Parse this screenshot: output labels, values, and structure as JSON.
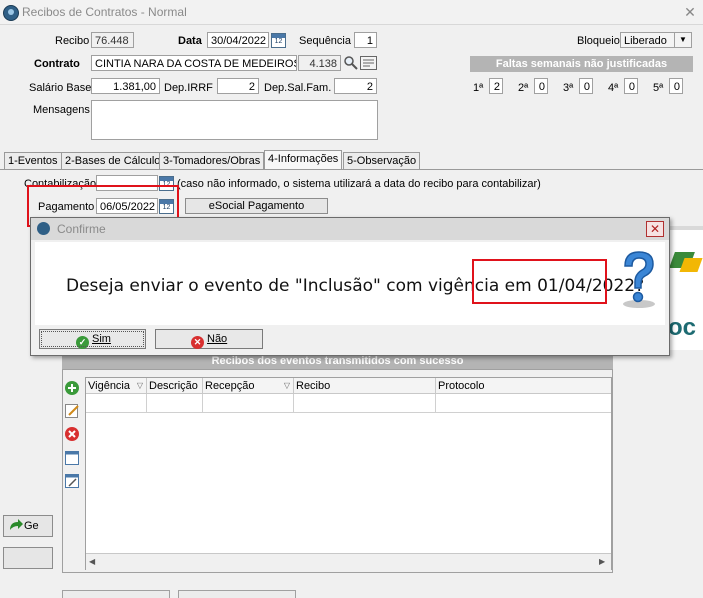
{
  "window": {
    "title": "Recibos de Contratos - Normal",
    "close": "✕"
  },
  "form": {
    "recibo_label": "Recibo",
    "recibo_value": "76.448",
    "data_label": "Data",
    "data_value": "30/04/2022",
    "sequencia_label": "Sequência",
    "sequencia_value": "1",
    "bloqueio_label": "Bloqueio",
    "bloqueio_value": "Liberado",
    "contrato_label": "Contrato",
    "contrato_name": "CINTIA NARA DA COSTA DE MEDEIROS",
    "contrato_code": "4.138",
    "salario_label": "Salário Base",
    "salario_value": "1.381,00",
    "irrf_label": "Dep.IRRF",
    "irrf_value": "2",
    "salfam_label": "Dep.Sal.Fam.",
    "salfam_value": "2",
    "mensagens_label": "Mensagens",
    "faltas_header": "Faltas semanais não justificadas",
    "faltas": [
      {
        "label": "1ª",
        "value": "2"
      },
      {
        "label": "2ª",
        "value": "0"
      },
      {
        "label": "3ª",
        "value": "0"
      },
      {
        "label": "4ª",
        "value": "0"
      },
      {
        "label": "5ª",
        "value": "0"
      }
    ]
  },
  "tabs": [
    "1-Eventos",
    "2-Bases de Cálculo",
    "3-Tomadores/Obras",
    "4-Informações",
    "5-Observação"
  ],
  "info": {
    "contabilizacao_label": "Contabilização",
    "contabilizacao_note": "(caso não informado, o sistema utilizará a data do recibo para contabilizar)",
    "pagamento_label": "Pagamento",
    "pagamento_value": "06/05/2022",
    "esocial_button": "eSocial Pagamento"
  },
  "dialog": {
    "title": "Confirme",
    "message_prefix": "Deseja enviar o evento de \"Inclusão\" com vigência em ",
    "message_date": "01/04/2022?",
    "yes": "Sim",
    "no": "Não"
  },
  "grid": {
    "header": "Recibos dos eventos transmitidos com sucesso",
    "columns": [
      "Vigência",
      "Descrição",
      "Recepção",
      "Recibo",
      "Protocolo"
    ]
  },
  "left_buttons": [
    "Ge",
    ""
  ],
  "right_partial_text": "oc"
}
